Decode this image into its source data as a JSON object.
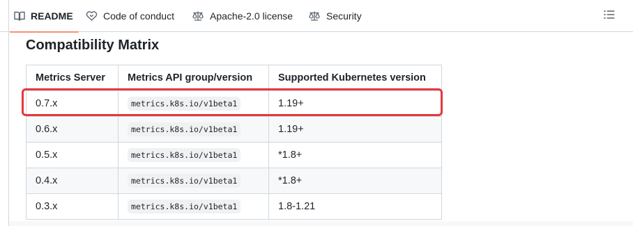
{
  "tabs": [
    {
      "label": "README",
      "icon": "book-icon",
      "active": true
    },
    {
      "label": "Code of conduct",
      "icon": "heart-handshake-icon",
      "active": false
    },
    {
      "label": "Apache-2.0 license",
      "icon": "law-scale-icon",
      "active": false
    },
    {
      "label": "Security",
      "icon": "law-scale-icon",
      "active": false
    }
  ],
  "outline_icon": "list-outline-icon",
  "section": {
    "title": "Compatibility Matrix"
  },
  "table": {
    "headers": [
      "Metrics Server",
      "Metrics API group/version",
      "Supported Kubernetes version"
    ],
    "rows": [
      [
        "0.7.x",
        "metrics.k8s.io/v1beta1",
        "1.19+"
      ],
      [
        "0.6.x",
        "metrics.k8s.io/v1beta1",
        "1.19+"
      ],
      [
        "0.5.x",
        "metrics.k8s.io/v1beta1",
        "*1.8+"
      ],
      [
        "0.4.x",
        "metrics.k8s.io/v1beta1",
        "*1.8+"
      ],
      [
        "0.3.x",
        "metrics.k8s.io/v1beta1",
        "1.8-1.21"
      ]
    ]
  },
  "colors": {
    "highlight": "#e5383b",
    "active_tab_underline": "#fd8c73"
  }
}
